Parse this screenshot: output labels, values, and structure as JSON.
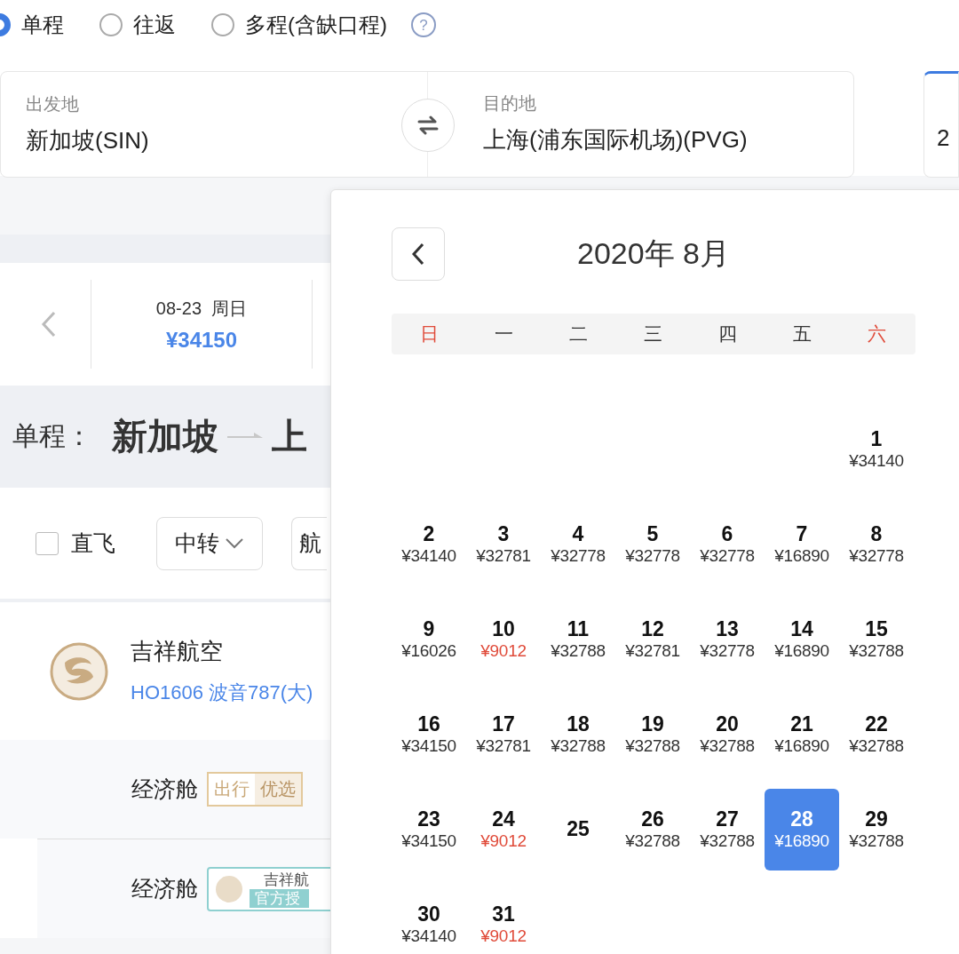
{
  "help_label": "?",
  "trip_types": [
    {
      "label": "单程",
      "selected": true
    },
    {
      "label": "往返",
      "selected": false
    },
    {
      "label": "多程(含缺口程)",
      "selected": false
    }
  ],
  "route": {
    "departure": {
      "label": "出发地",
      "value": "新加坡(SIN)"
    },
    "arrival": {
      "label": "目的地",
      "value": "上海(浦东国际机场)(PVG)"
    },
    "date_card_partial": "2"
  },
  "date_strip": {
    "items": [
      {
        "date": "08-23",
        "weekday": "周日",
        "price": "¥34150",
        "selected": true
      }
    ]
  },
  "heading": {
    "prefix": "单程：",
    "origin": "新加坡",
    "destination_partial": "上"
  },
  "filters": {
    "direct": {
      "label": "直飞",
      "checked": false
    },
    "transfer": "中转",
    "airline_partial": "航"
  },
  "flight": {
    "airline": "吉祥航空",
    "flight_info": "HO1606 波音787(大)",
    "fares": [
      {
        "cabin": "经济舱",
        "kind": "preferred",
        "tag": [
          "出行",
          "优选"
        ]
      },
      {
        "cabin": "经济舱",
        "kind": "official",
        "tag": [
          "吉祥航",
          "官方授"
        ]
      }
    ]
  },
  "calendar": {
    "title": "2020年 8月",
    "weekdays": [
      {
        "label": "日",
        "weekend": true
      },
      {
        "label": "一",
        "weekend": false
      },
      {
        "label": "二",
        "weekend": false
      },
      {
        "label": "三",
        "weekend": false
      },
      {
        "label": "四",
        "weekend": false
      },
      {
        "label": "五",
        "weekend": false
      },
      {
        "label": "六",
        "weekend": true
      }
    ],
    "days": [
      {
        "day": "1",
        "price": "¥34140",
        "lowest": false,
        "selected": false
      },
      {
        "day": "2",
        "price": "¥34140",
        "lowest": false,
        "selected": false
      },
      {
        "day": "3",
        "price": "¥32781",
        "lowest": false,
        "selected": false
      },
      {
        "day": "4",
        "price": "¥32778",
        "lowest": false,
        "selected": false
      },
      {
        "day": "5",
        "price": "¥32778",
        "lowest": false,
        "selected": false
      },
      {
        "day": "6",
        "price": "¥32778",
        "lowest": false,
        "selected": false
      },
      {
        "day": "7",
        "price": "¥16890",
        "lowest": false,
        "selected": false
      },
      {
        "day": "8",
        "price": "¥32778",
        "lowest": false,
        "selected": false
      },
      {
        "day": "9",
        "price": "¥16026",
        "lowest": false,
        "selected": false
      },
      {
        "day": "10",
        "price": "¥9012",
        "lowest": true,
        "selected": false
      },
      {
        "day": "11",
        "price": "¥32788",
        "lowest": false,
        "selected": false
      },
      {
        "day": "12",
        "price": "¥32781",
        "lowest": false,
        "selected": false
      },
      {
        "day": "13",
        "price": "¥32778",
        "lowest": false,
        "selected": false
      },
      {
        "day": "14",
        "price": "¥16890",
        "lowest": false,
        "selected": false
      },
      {
        "day": "15",
        "price": "¥32788",
        "lowest": false,
        "selected": false
      },
      {
        "day": "16",
        "price": "¥34150",
        "lowest": false,
        "selected": false
      },
      {
        "day": "17",
        "price": "¥32781",
        "lowest": false,
        "selected": false
      },
      {
        "day": "18",
        "price": "¥32788",
        "lowest": false,
        "selected": false
      },
      {
        "day": "19",
        "price": "¥32788",
        "lowest": false,
        "selected": false
      },
      {
        "day": "20",
        "price": "¥32788",
        "lowest": false,
        "selected": false
      },
      {
        "day": "21",
        "price": "¥16890",
        "lowest": false,
        "selected": false
      },
      {
        "day": "22",
        "price": "¥32788",
        "lowest": false,
        "selected": false
      },
      {
        "day": "23",
        "price": "¥34150",
        "lowest": false,
        "selected": false
      },
      {
        "day": "24",
        "price": "¥9012",
        "lowest": true,
        "selected": false
      },
      {
        "day": "25",
        "selected": false
      },
      {
        "day": "26",
        "price": "¥32788",
        "lowest": false,
        "selected": false
      },
      {
        "day": "27",
        "price": "¥32788",
        "lowest": false,
        "selected": false
      },
      {
        "day": "28",
        "price": "¥16890",
        "lowest": false,
        "selected": true
      },
      {
        "day": "29",
        "price": "¥32788",
        "lowest": false,
        "selected": false
      },
      {
        "day": "30",
        "price": "¥34140",
        "lowest": false,
        "selected": false
      },
      {
        "day": "31",
        "price": "¥9012",
        "lowest": true,
        "selected": false
      }
    ]
  }
}
